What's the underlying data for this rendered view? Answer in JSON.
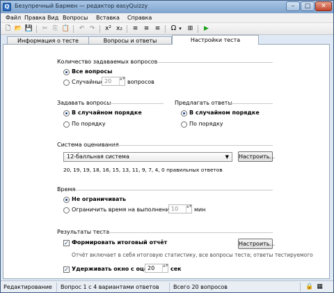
{
  "window": {
    "title": "Безупречный Бармен — редактор easyQuizzy",
    "app_icon_glyph": "Q",
    "min_glyph": "–",
    "max_glyph": "□",
    "close_glyph": "✕"
  },
  "menu": [
    "Файл",
    "Правка",
    "Вид",
    "Вопросы",
    "Вставка",
    "Справка"
  ],
  "toolbar": {
    "new_icon": "🗋",
    "open_icon": "📂",
    "save_icon": "💾",
    "cut_icon": "✂",
    "copy_icon": "⎘",
    "paste_icon": "📋",
    "undo_icon": "↶",
    "redo_icon": "↷",
    "superscript_label": "x²",
    "subscript_label": "x₂",
    "align_left_icon": "≡",
    "align_center_icon": "≡",
    "align_right_icon": "≡",
    "symbol_label": "Ω",
    "symbol_dropdown": "▾",
    "special_icon": "⊞",
    "run_icon": "▶",
    "run_color": "#1aa11a"
  },
  "tabs": [
    "Информация о тесте",
    "Вопросы и ответы",
    "Настройки теста"
  ],
  "settings": {
    "question_count": {
      "title": "Количество задаваемых вопросов",
      "all_label": "Все вопросы",
      "random_label": "Случайные",
      "random_value": "20",
      "random_suffix": "вопросов"
    },
    "ask_questions": {
      "title": "Задавать вопросы",
      "random_order": "В случайном порядке",
      "in_order": "По порядку"
    },
    "offer_answers": {
      "title": "Предлагать ответы",
      "random_order": "В случайном порядке",
      "in_order": "По порядку"
    },
    "grading": {
      "title": "Система оценивания",
      "selected": "12-балльная система",
      "configure_button": "Настроить...",
      "thresholds": "20, 19, 19, 18, 16, 15, 13, 11, 9, 7, 4, 0 правильных ответов"
    },
    "time": {
      "title": "Время",
      "no_limit": "Не ограничивать",
      "limit_label": "Ограничить время на выполнение теста",
      "limit_value": "10",
      "limit_unit": "мин"
    },
    "results": {
      "title": "Результаты теста",
      "form_report": "Формировать итоговый отчёт",
      "configure_button": "Настроить...",
      "report_note": "Отчёт включает в себя итоговую статистику, все вопросы теста; ответы тестируемого",
      "hold_window": "Удерживать окно с оценкой",
      "hold_value": "20",
      "hold_unit": "сек",
      "check_glyph": "✓"
    }
  },
  "status": {
    "mode": "Редактирование",
    "question_info": "Вопрос 1 с 4 вариантами ответов",
    "total": "Всего 20 вопросов",
    "lock_icon": "🔒",
    "grid_icon": "▦"
  },
  "spin_arrows": "▲▼"
}
